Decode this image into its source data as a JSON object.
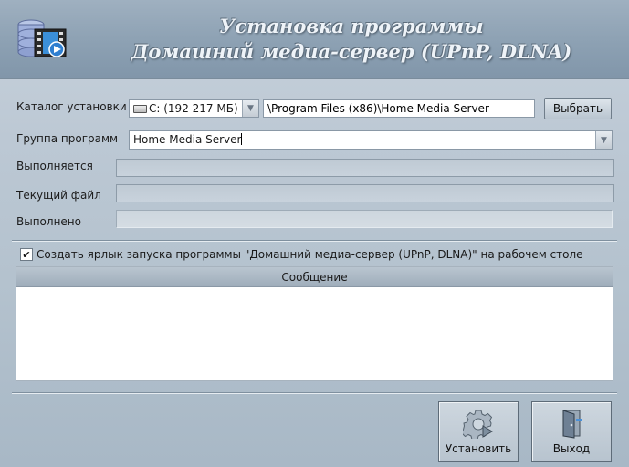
{
  "header": {
    "title_line1": "Установка программы",
    "title_line2": "Домашний медиа-сервер (UPnP, DLNA)",
    "logo_icon": "media-server-logo-icon"
  },
  "form": {
    "install_dir_label": "Каталог установки",
    "drive_value": "C: (192 217 МБ)",
    "drive_icon": "hard-drive-icon",
    "path_value": "\\Program Files (x86)\\Home Media Server",
    "browse_label": "Выбрать",
    "group_label": "Группа программ",
    "group_value": "Home Media Server",
    "running_label": "Выполняется",
    "current_file_label": "Текущий файл",
    "done_label": "Выполнено",
    "progress_percent": 0
  },
  "shortcut": {
    "checked": true,
    "label": "Создать ярлык запуска программы \"Домашний медиа-сервер (UPnP, DLNA)\" на рабочем столе"
  },
  "messages": {
    "header": "Сообщение",
    "rows": []
  },
  "buttons": {
    "install_label": "Установить",
    "install_icon": "gear-play-icon",
    "exit_label": "Выход",
    "exit_icon": "door-exit-icon"
  },
  "colors": {
    "header_bg": "#8ea2b4",
    "body_bg": "#b4c2ce",
    "progress_fill": "#5a8ac4"
  }
}
